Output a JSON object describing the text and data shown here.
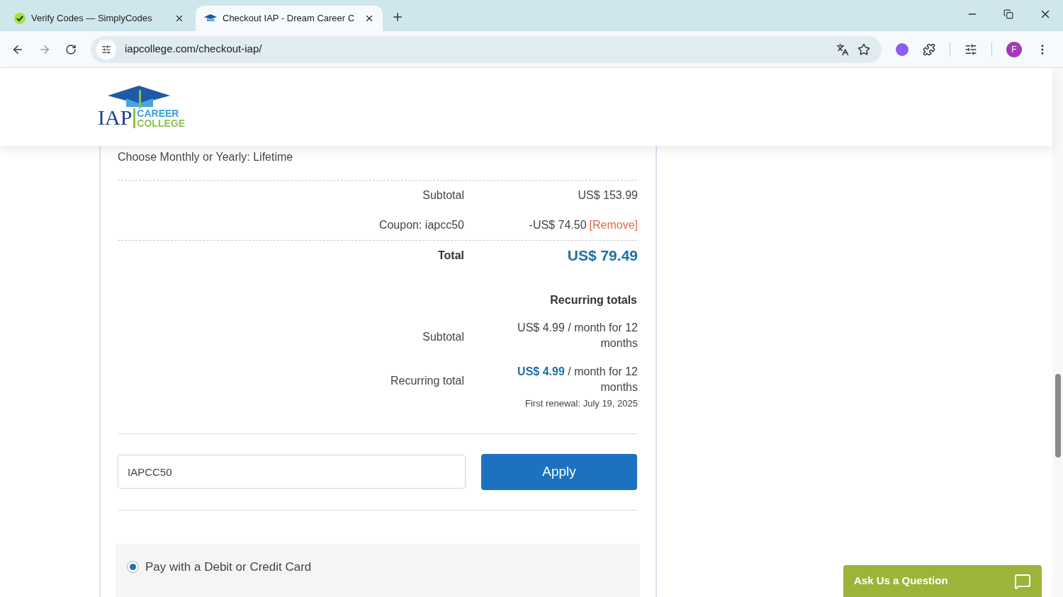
{
  "browser": {
    "tabs": [
      {
        "title": "Verify Codes — SimplyCodes",
        "kind": "check",
        "selected": false
      },
      {
        "title": "Checkout IAP - Dream Career C",
        "kind": "cap",
        "selected": true
      }
    ],
    "address": "iapcollege.com/checkout-iap/",
    "profile": "F"
  },
  "logo": {
    "main": "IAP",
    "line1": "CAREER",
    "line2": "COLLEGE"
  },
  "order": {
    "plan": "Choose Monthly or Yearly: Lifetime",
    "rows": [
      {
        "label": "Subtotal",
        "value": "US$ 153.99"
      },
      {
        "label": "Coupon: iapcc50",
        "value": "-US$ 74.50",
        "link": "[Remove]"
      }
    ],
    "total": {
      "label": "Total",
      "value": "US$ 79.49"
    },
    "recurring": {
      "heading": "Recurring totals",
      "rows": [
        {
          "label": "Subtotal",
          "amount": "US$ 4.99",
          "suffix": "/ month for 12 months",
          "emphasized": false
        },
        {
          "label": "Recurring total",
          "amount": "US$ 4.99",
          "suffix": "/ month for 12 months",
          "emphasized": true,
          "note": "First renewal: July 19, 2025"
        }
      ]
    }
  },
  "coupon": {
    "value": "IAPCC50",
    "button": "Apply"
  },
  "payment": {
    "options": [
      {
        "label": "Pay with a Debit or Credit Card",
        "selected": true
      }
    ]
  },
  "chat": {
    "label": "Ask Us a Question"
  }
}
